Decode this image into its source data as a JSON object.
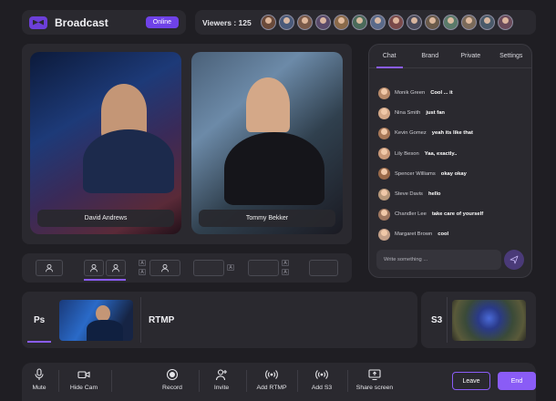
{
  "header": {
    "brand": "Broadcast",
    "status_badge": "Online",
    "viewers_label": "Viewers : 125",
    "viewer_avatar_count": 14
  },
  "stage": {
    "videos": [
      {
        "name": "David Andrews"
      },
      {
        "name": "Tommy Bekker"
      }
    ]
  },
  "chat": {
    "tabs": [
      "Chat",
      "Brand",
      "Private",
      "Settings"
    ],
    "active_tab": "Chat",
    "messages": [
      {
        "name": "Monik Green",
        "text": "Cool ... it"
      },
      {
        "name": "Nina Smith",
        "text": "just fan"
      },
      {
        "name": "Kevin Gomez",
        "text": "yeah its like that"
      },
      {
        "name": "Lily Beson",
        "text": "Yaa, exactly.."
      },
      {
        "name": "Spencer Williams",
        "text": "okay okay"
      },
      {
        "name": "Steve Davis",
        "text": "hello"
      },
      {
        "name": "Chandler Lee",
        "text": "take care of yourself"
      },
      {
        "name": "Margaret Brown",
        "text": "cool"
      }
    ],
    "input_placeholder": "Write something ..."
  },
  "sources": {
    "left_label": "Ps",
    "rtmp_label": "RTMP",
    "s3_label": "S3"
  },
  "toolbar": {
    "items": [
      "Mute",
      "Hide Cam",
      "Record",
      "Invite",
      "Add RTMP",
      "Add S3",
      "Share screen"
    ],
    "leave": "Leave",
    "end": "End"
  },
  "colors": {
    "accent": "#8a5cf6",
    "background": "#1f1e23",
    "panel": "#2a292f"
  }
}
